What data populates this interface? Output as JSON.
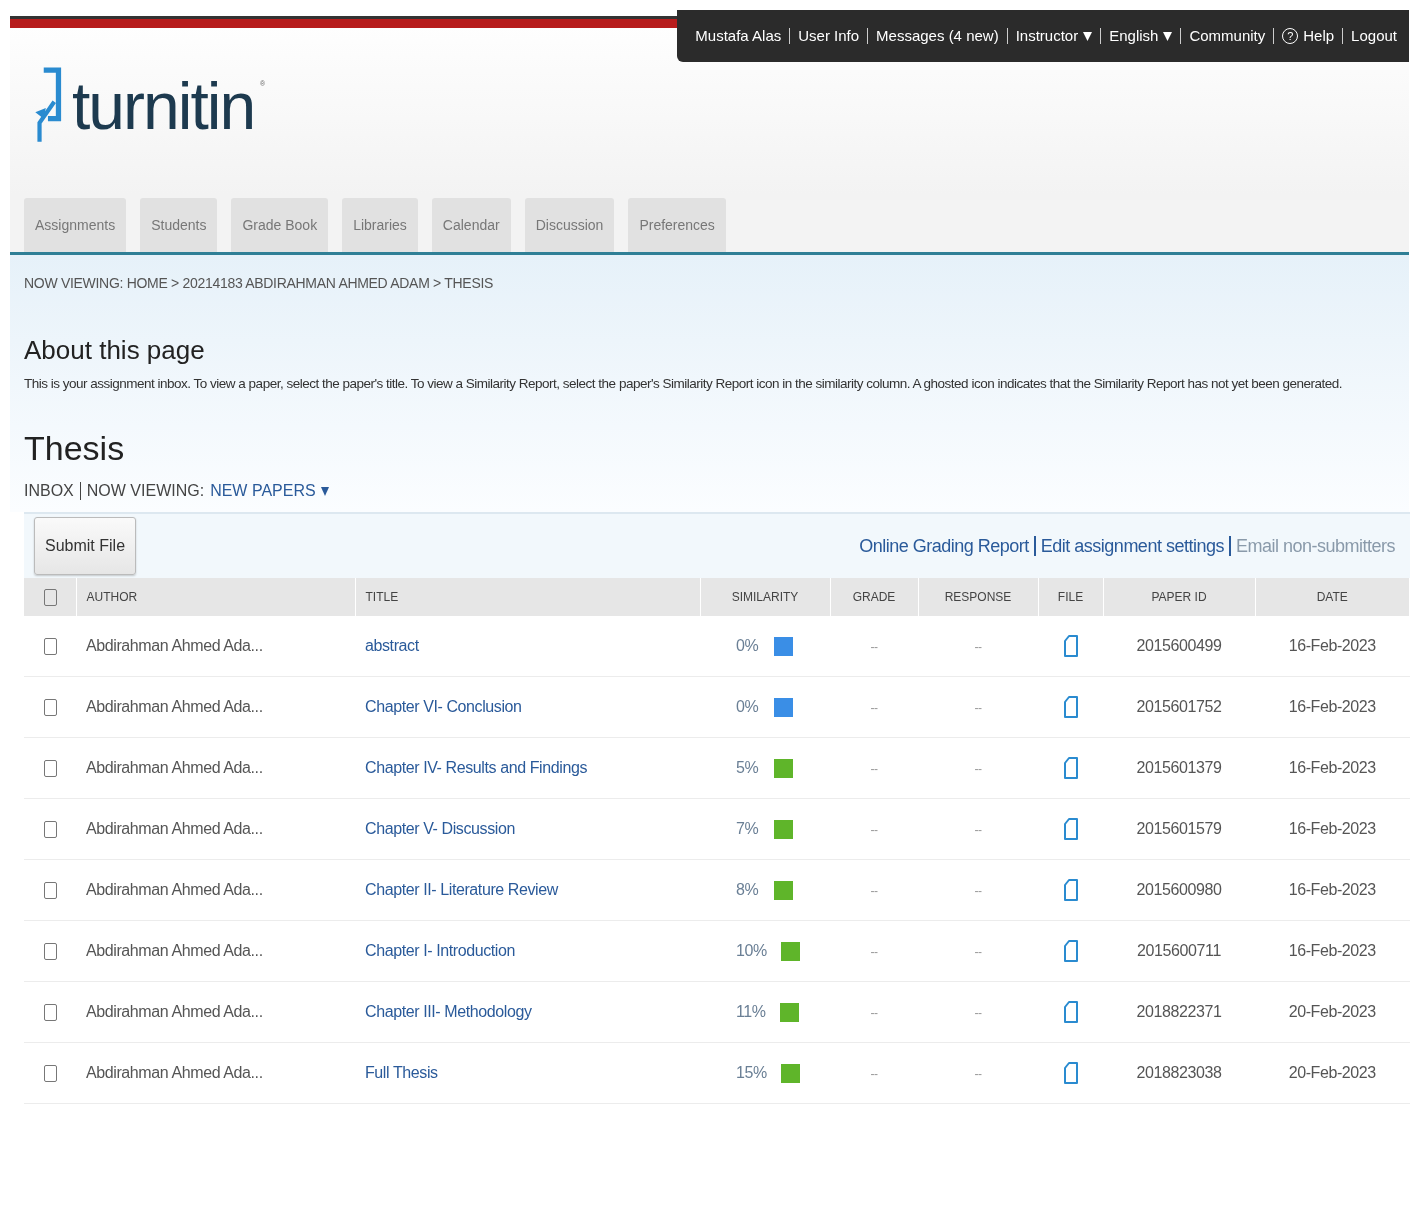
{
  "top_nav": [
    {
      "kind": "text",
      "label": "Mustafa Alas"
    },
    {
      "kind": "link",
      "label": "User Info"
    },
    {
      "kind": "link",
      "label": "Messages (4 new)"
    },
    {
      "kind": "dropdown",
      "label": "Instructor"
    },
    {
      "kind": "dropdown",
      "label": "English"
    },
    {
      "kind": "link",
      "label": "Community"
    },
    {
      "kind": "help",
      "icon": "?",
      "label": "Help"
    },
    {
      "kind": "link",
      "label": "Logout"
    }
  ],
  "logo": {
    "text": "turnitin",
    "mark": "®"
  },
  "tabs": [
    {
      "label": "Assignments",
      "selected": false
    },
    {
      "label": "Students",
      "selected": false
    },
    {
      "label": "Grade Book",
      "selected": false
    },
    {
      "label": "Libraries",
      "selected": false
    },
    {
      "label": "Calendar",
      "selected": false
    },
    {
      "label": "Discussion",
      "selected": false
    },
    {
      "label": "Preferences",
      "selected": false
    }
  ],
  "breadcrumb": "NOW VIEWING: HOME > 20214183 ABDIRAHMAN AHMED ADAM > THESIS",
  "about": {
    "title": "About this page",
    "text": "This is your assignment inbox. To view a paper, select the paper's title. To view a Similarity Report, select the paper's Similarity Report icon in the similarity column. A ghosted icon indicates that the Similarity Report has not yet been generated."
  },
  "assignment": {
    "title": "Thesis",
    "inbox": "INBOX",
    "viewing_label": "NOW VIEWING:",
    "viewing_value": "NEW PAPERS"
  },
  "submit_button": "Submit File",
  "actions": [
    {
      "label": "Online Grading Report",
      "disabled": false
    },
    {
      "label": "Edit assignment settings",
      "disabled": false
    },
    {
      "label": "Email non-submitters",
      "disabled": true
    }
  ],
  "table": {
    "select_all": {
      "checked": false
    },
    "columns": [
      "AUTHOR",
      "TITLE",
      "SIMILARITY",
      "GRADE",
      "RESPONSE",
      "FILE",
      "PAPER ID",
      "DATE"
    ],
    "rows": [
      {
        "checked": false,
        "author": "Abdirahman Ahmed Ada...",
        "title": "abstract",
        "similarity": "0%",
        "color": "#3a8ee6",
        "grade": "--",
        "response": "--",
        "paper_id": "2015600499",
        "date": "16-Feb-2023"
      },
      {
        "checked": false,
        "author": "Abdirahman Ahmed Ada...",
        "title": "Chapter VI- Conclusion",
        "similarity": "0%",
        "color": "#3a8ee6",
        "grade": "--",
        "response": "--",
        "paper_id": "2015601752",
        "date": "16-Feb-2023"
      },
      {
        "checked": false,
        "author": "Abdirahman Ahmed Ada...",
        "title": "Chapter IV- Results and Findings",
        "similarity": "5%",
        "color": "#5fb52a",
        "grade": "--",
        "response": "--",
        "paper_id": "2015601379",
        "date": "16-Feb-2023"
      },
      {
        "checked": false,
        "author": "Abdirahman Ahmed Ada...",
        "title": "Chapter V- Discussion",
        "similarity": "7%",
        "color": "#5fb52a",
        "grade": "--",
        "response": "--",
        "paper_id": "2015601579",
        "date": "16-Feb-2023"
      },
      {
        "checked": false,
        "author": "Abdirahman Ahmed Ada...",
        "title": "Chapter II- Literature Review",
        "similarity": "8%",
        "color": "#5fb52a",
        "grade": "--",
        "response": "--",
        "paper_id": "2015600980",
        "date": "16-Feb-2023"
      },
      {
        "checked": false,
        "author": "Abdirahman Ahmed Ada...",
        "title": "Chapter I- Introduction",
        "similarity": "10%",
        "color": "#5fb52a",
        "grade": "--",
        "response": "--",
        "paper_id": "2015600711",
        "date": "16-Feb-2023"
      },
      {
        "checked": false,
        "author": "Abdirahman Ahmed Ada...",
        "title": "Chapter III- Methodology",
        "similarity": "11%",
        "color": "#5fb52a",
        "grade": "--",
        "response": "--",
        "paper_id": "2018822371",
        "date": "20-Feb-2023"
      },
      {
        "checked": false,
        "author": "Abdirahman Ahmed Ada...",
        "title": "Full Thesis",
        "similarity": "15%",
        "color": "#5fb52a",
        "grade": "--",
        "response": "--",
        "paper_id": "2018823038",
        "date": "20-Feb-2023"
      }
    ]
  }
}
